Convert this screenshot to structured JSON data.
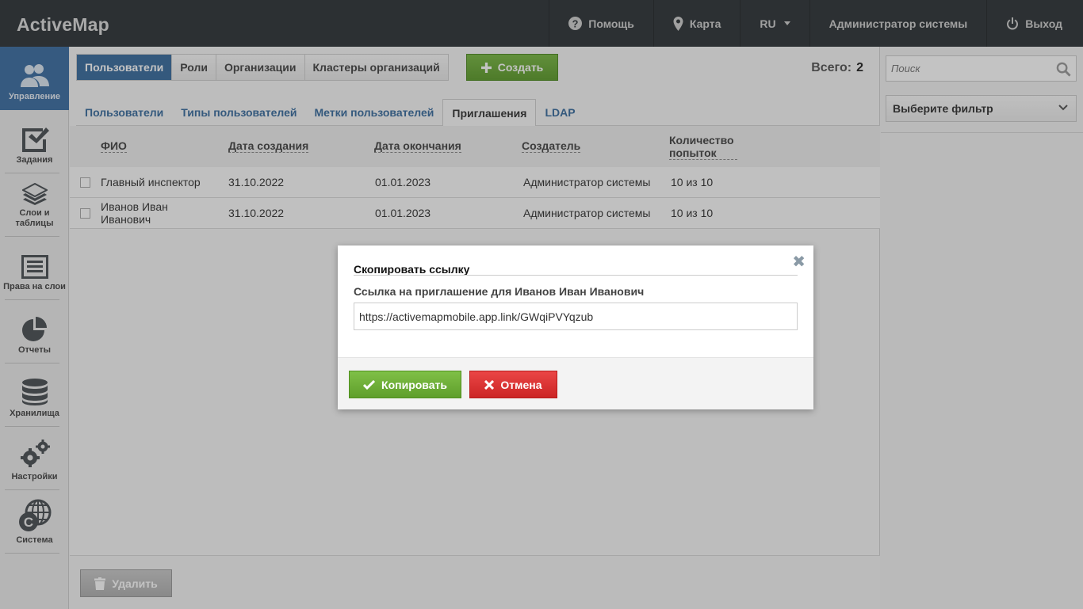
{
  "app": {
    "title": "ActiveMap"
  },
  "topnav": {
    "help": "Помощь",
    "map": "Карта",
    "lang": "RU",
    "user": "Администратор системы",
    "logout": "Выход"
  },
  "sidebar": {
    "items": [
      {
        "label": "Управление",
        "icon": "users-icon",
        "active": true
      },
      {
        "label": "Задания",
        "icon": "checkbox-icon"
      },
      {
        "label": "Слои и таблицы",
        "icon": "layers-icon"
      },
      {
        "label": "Права на слои",
        "icon": "list-icon"
      },
      {
        "label": "Отчеты",
        "icon": "pie-chart-icon"
      },
      {
        "label": "Хранилища",
        "icon": "database-icon"
      },
      {
        "label": "Настройки",
        "icon": "gears-icon"
      },
      {
        "label": "Система",
        "icon": "globe-icon"
      }
    ]
  },
  "toolbar": {
    "tabs": [
      "Пользователи",
      "Роли",
      "Организации",
      "Кластеры организаций"
    ],
    "create_label": "Создать",
    "total_label": "Всего:",
    "total_value": "2"
  },
  "subtabs": [
    "Пользователи",
    "Типы пользователей",
    "Метки пользователей",
    "Приглашения",
    "LDAP"
  ],
  "table": {
    "columns": [
      "ФИО",
      "Дата создания",
      "Дата окончания",
      "Создатель",
      "Количество попыток"
    ],
    "rows": [
      {
        "name": "Главный инспектор",
        "created": "31.10.2022",
        "expires": "01.01.2023",
        "creator": "Администратор системы",
        "attempts": "10 из 10"
      },
      {
        "name": "Иванов Иван Иванович",
        "created": "31.10.2022",
        "expires": "01.01.2023",
        "creator": "Администратор системы",
        "attempts": "10 из 10"
      }
    ]
  },
  "footer": {
    "delete_label": "Удалить"
  },
  "rightpanel": {
    "search_placeholder": "Поиск",
    "filter_label": "Выберите фильтр"
  },
  "modal": {
    "title": "Скопировать ссылку",
    "label": "Ссылка на приглашение для Иванов Иван Иванович",
    "link": "https://activemapmobile.app.link/GWqiPVYqzub",
    "copy_label": "Копировать",
    "cancel_label": "Отмена",
    "close_glyph": "✖"
  }
}
